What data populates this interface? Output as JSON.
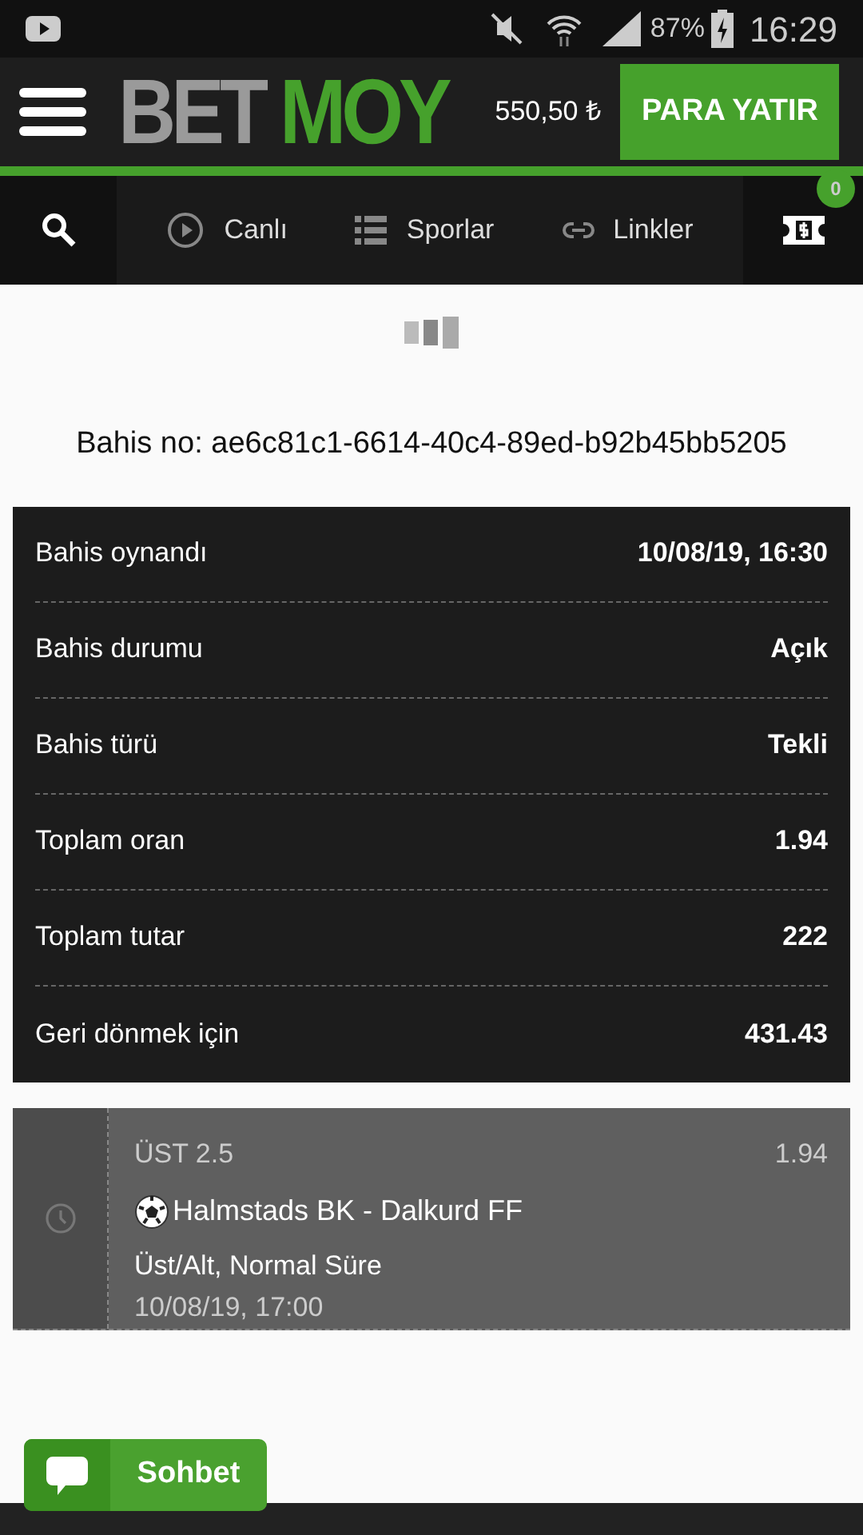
{
  "status_bar": {
    "battery": "87%",
    "time": "16:29"
  },
  "header": {
    "logo_left": "BET",
    "logo_right": "MOY",
    "balance": "550,50 ₺",
    "deposit_button": "PARA YATIR"
  },
  "nav": {
    "tabs": [
      {
        "label": "Canlı",
        "kind": "live"
      },
      {
        "label": "Sporlar",
        "kind": "sports"
      },
      {
        "label": "Linkler",
        "kind": "links"
      }
    ],
    "betslip_count": "0"
  },
  "bet_number": "Bahis no: ae6c81c1-6614-40c4-89ed-b92b45bb5205",
  "details": [
    {
      "label": "Bahis oynandı",
      "value": "10/08/19, 16:30"
    },
    {
      "label": "Bahis durumu",
      "value": "Açık"
    },
    {
      "label": "Bahis türü",
      "value": "Tekli"
    },
    {
      "label": "Toplam oran",
      "value": "1.94"
    },
    {
      "label": "Toplam tutar",
      "value": "222"
    },
    {
      "label": "Geri dönmek için",
      "value": "431.43"
    }
  ],
  "selection": {
    "pick": "ÜST 2.5",
    "odds": "1.94",
    "match": "Halmstads BK - Dalkurd FF",
    "market": "Üst/Alt, Normal Süre",
    "date": "10/08/19, 17:00"
  },
  "chat_button": "Sohbet"
}
